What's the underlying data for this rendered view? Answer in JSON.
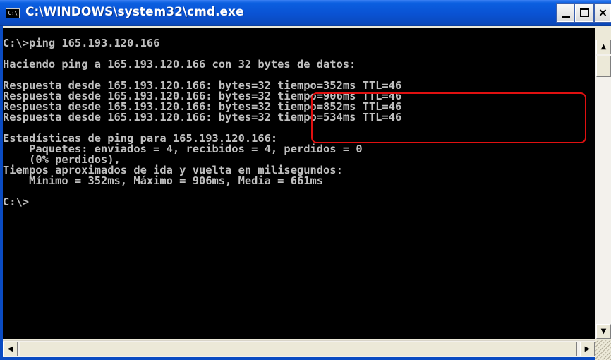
{
  "window": {
    "title": "C:\\WINDOWS\\system32\\cmd.exe",
    "icon_label": "C:\\",
    "controls": {
      "minimize": "minimize",
      "maximize": "maximize",
      "close": "×"
    }
  },
  "console": {
    "lines": [
      "",
      "C:\\>ping 165.193.120.166",
      "",
      "Haciendo ping a 165.193.120.166 con 32 bytes de datos:",
      "",
      "Respuesta desde 165.193.120.166: bytes=32 tiempo=352ms TTL=46",
      "Respuesta desde 165.193.120.166: bytes=32 tiempo=906ms TTL=46",
      "Respuesta desde 165.193.120.166: bytes=32 tiempo=852ms TTL=46",
      "Respuesta desde 165.193.120.166: bytes=32 tiempo=534ms TTL=46",
      "",
      "Estadísticas de ping para 165.193.120.166:",
      "    Paquetes: enviados = 4, recibidos = 4, perdidos = 0",
      "    (0% perdidos),",
      "Tiempos aproximados de ida y vuelta en milisegundos:",
      "    Mínimo = 352ms, Máximo = 906ms, Media = 661ms",
      "",
      "C:\\>"
    ],
    "colors": {
      "background": "#000000",
      "foreground": "#C0C0C0",
      "highlight": "#E01010"
    }
  },
  "scrollbars": {
    "up_arrow": "▲",
    "down_arrow": "▼",
    "left_arrow": "◀",
    "right_arrow": "▶"
  }
}
